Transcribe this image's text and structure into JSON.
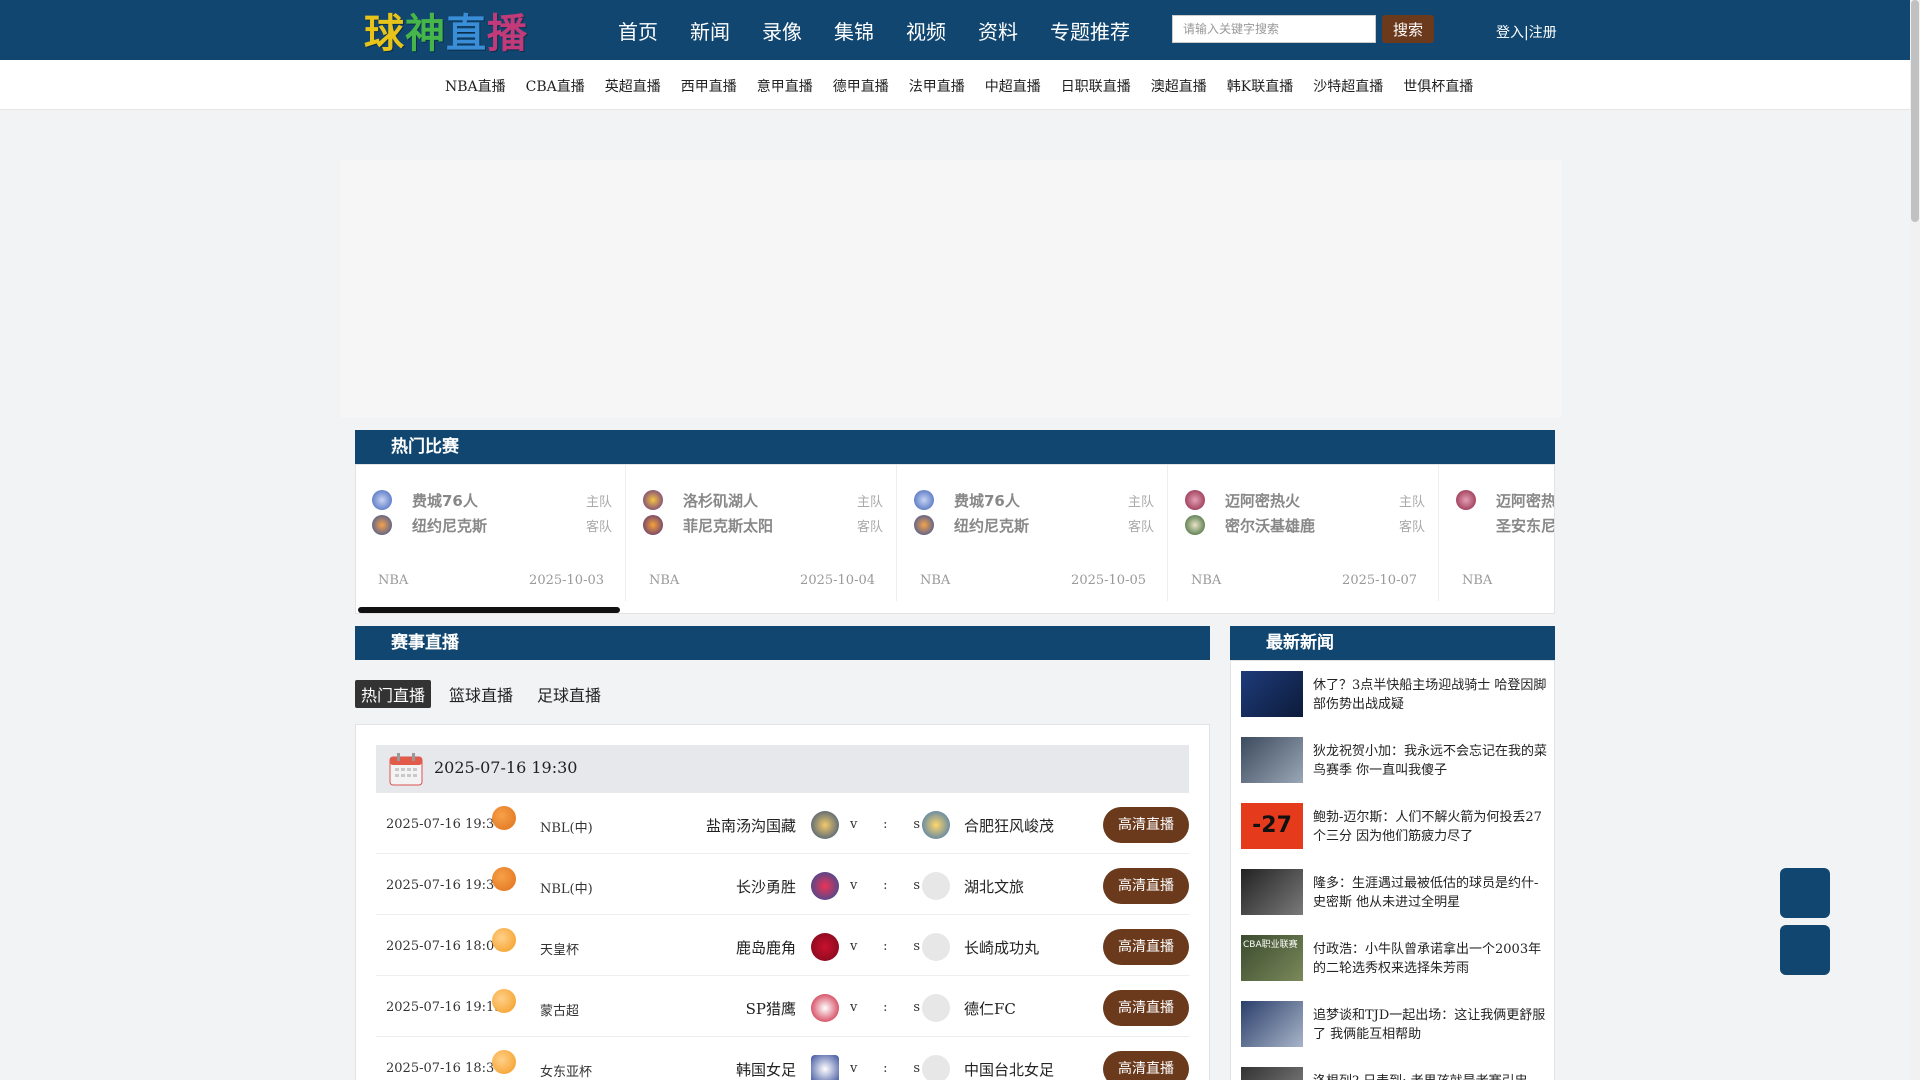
{
  "header": {
    "logo_chars": [
      "球",
      "神",
      "直",
      "播"
    ],
    "nav": [
      "首页",
      "新闻",
      "录像",
      "集锦",
      "视频",
      "资料",
      "专题推荐"
    ],
    "search_placeholder": "请输入关键字搜索",
    "search_button": "搜索",
    "login": "登入|注册"
  },
  "subnav": [
    "NBA直播",
    "CBA直播",
    "英超直播",
    "西甲直播",
    "意甲直播",
    "德甲直播",
    "法甲直播",
    "中超直播",
    "日职联直播",
    "澳超直播",
    "韩K联直播",
    "沙特超直播",
    "世俱杯直播"
  ],
  "hot": {
    "title": "热门比赛",
    "home_label": "主队",
    "away_label": "客队",
    "cards": [
      {
        "home": "费城76人",
        "away": "纽约尼克斯",
        "league": "NBA",
        "date": "2025-10-03"
      },
      {
        "home": "洛杉矶湖人",
        "away": "菲尼克斯太阳",
        "league": "NBA",
        "date": "2025-10-04"
      },
      {
        "home": "费城76人",
        "away": "纽约尼克斯",
        "league": "NBA",
        "date": "2025-10-05"
      },
      {
        "home": "迈阿密热火",
        "away": "密尔沃基雄鹿",
        "league": "NBA",
        "date": "2025-10-07"
      },
      {
        "home": "迈阿密热",
        "away": "圣安东尼奥马",
        "league": "NBA",
        "date": ""
      }
    ]
  },
  "live": {
    "title": "赛事直播",
    "tabs": [
      "热门直播",
      "篮球直播",
      "足球直播"
    ],
    "date_header": "2025-07-16 19:30",
    "vs": "v",
    "colon": ":",
    "s": "s",
    "matches": [
      {
        "time": "2025-07-16 19:30",
        "sport": "basketball",
        "league": "NBL(中)",
        "home": "盐南汤沟国藏",
        "away": "合肥狂风峻茂",
        "button": "高清直播"
      },
      {
        "time": "2025-07-16 19:30",
        "sport": "basketball",
        "league": "NBL(中)",
        "home": "长沙勇胜",
        "away": "湖北文旅",
        "button": "高清直播"
      },
      {
        "time": "2025-07-16 18:00",
        "sport": "football",
        "league": "天皇杯",
        "home": "鹿岛鹿角",
        "away": "长崎成功丸",
        "button": "高清直播"
      },
      {
        "time": "2025-07-16 19:15",
        "sport": "football",
        "league": "蒙古超",
        "home": "SP猎鹰",
        "away": "德仁FC",
        "button": "高清直播"
      },
      {
        "time": "2025-07-16 18:30",
        "sport": "football",
        "league": "女东亚杯",
        "home": "韩国女足",
        "away": "中国台北女足",
        "button": "高清直播"
      }
    ]
  },
  "news": {
    "title": "最新新闻",
    "items": [
      "休了？3点半快船主场迎战骑士 哈登因脚部伤势出战成疑",
      "狄龙祝贺小加：我永远不会忘记在我的菜鸟赛季 你一直叫我傻子",
      "鲍勃-迈尔斯：人们不解火箭为何投丢27个三分 因为他们筋疲力尽了",
      "隆多：生涯遇过最被低估的球员是约什-史密斯 他从未进过全明星",
      "付政浩：小牛队曾承诺拿出一个2003年的二轮选秀权来选择朱芳雨",
      "追梦谈和TJD一起出场：这让我俩更舒服了 我俩能互相帮助",
      "洛根列? 日表到: 老男孩就是老赛引忠"
    ],
    "thumb_badge": "-27",
    "thumb_badge2": "CBA职业联赛"
  },
  "colors": {
    "primary": "#10466f",
    "button_brown": "#6b3a1c"
  }
}
